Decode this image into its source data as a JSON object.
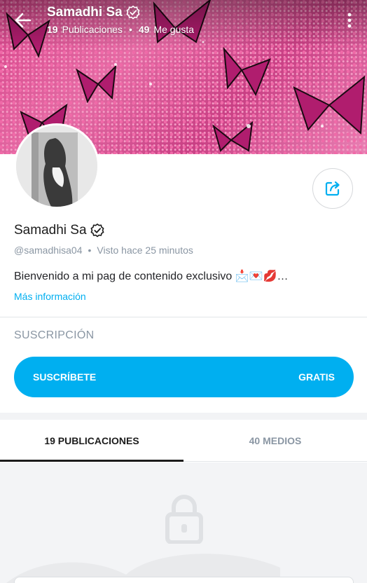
{
  "header": {
    "title": "Samadhi Sa",
    "posts_count": "19",
    "posts_label": "Publicaciones",
    "separator": "•",
    "likes_count": "49",
    "likes_label": "Me gusta"
  },
  "profile": {
    "name": "Samadhi Sa",
    "handle": "@samadhisa04",
    "separator": "•",
    "last_seen": "Visto hace 25 minutos",
    "bio": "Bienvenido a mi pag de contenido exclusivo 📩💌💋…",
    "more_info": "Más información"
  },
  "subscription": {
    "heading": "SUSCRIPCIÓN",
    "button_label": "SUSCRÍBETE",
    "price": "GRATIS"
  },
  "tabs": [
    {
      "label": "19 PUBLICACIONES",
      "active": true
    },
    {
      "label": "40 MEDIOS",
      "active": false
    }
  ],
  "colors": {
    "accent": "#00aff0",
    "muted_text": "#8a96a3",
    "cover_pink": "#d8438a"
  },
  "icons": {
    "back": "arrow-left-icon",
    "more": "more-vertical-icon",
    "verified": "verified-badge-icon",
    "share": "share-icon",
    "lock": "lock-icon"
  }
}
